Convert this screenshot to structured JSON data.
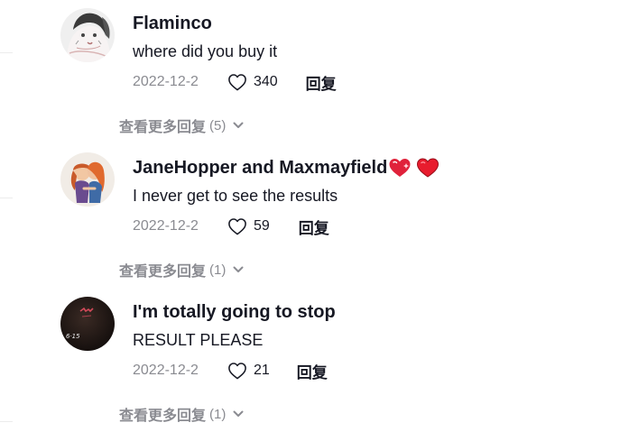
{
  "comments": [
    {
      "username": "Flaminco",
      "text": "where did you buy it",
      "date": "2022-12-2",
      "likes": "340",
      "reply_label": "回复",
      "more_replies_label": "查看更多回复",
      "more_replies_count": "(5)",
      "avatar": "avatar-manga-drawing",
      "badges": []
    },
    {
      "username": "JaneHopper and Maxmayfield",
      "text": "I never get to see the results",
      "date": "2022-12-2",
      "likes": "59",
      "reply_label": "回复",
      "more_replies_label": "查看更多回复",
      "more_replies_count": "(1)",
      "avatar": "avatar-cartoon-couple",
      "badges": [
        "heart-sparkle-emoji",
        "red-heart-emoji"
      ]
    },
    {
      "username": "I'm totally going to stop",
      "text": "RESULT PLEASE",
      "date": "2022-12-2",
      "likes": "21",
      "reply_label": "回复",
      "more_replies_label": "查看更多回复",
      "more_replies_count": "(1)",
      "avatar": "avatar-dark-photo",
      "badges": []
    }
  ],
  "colors": {
    "primary_text": "#161823",
    "secondary_text": "#8a8b91",
    "heart_red": "#fe2c55"
  }
}
